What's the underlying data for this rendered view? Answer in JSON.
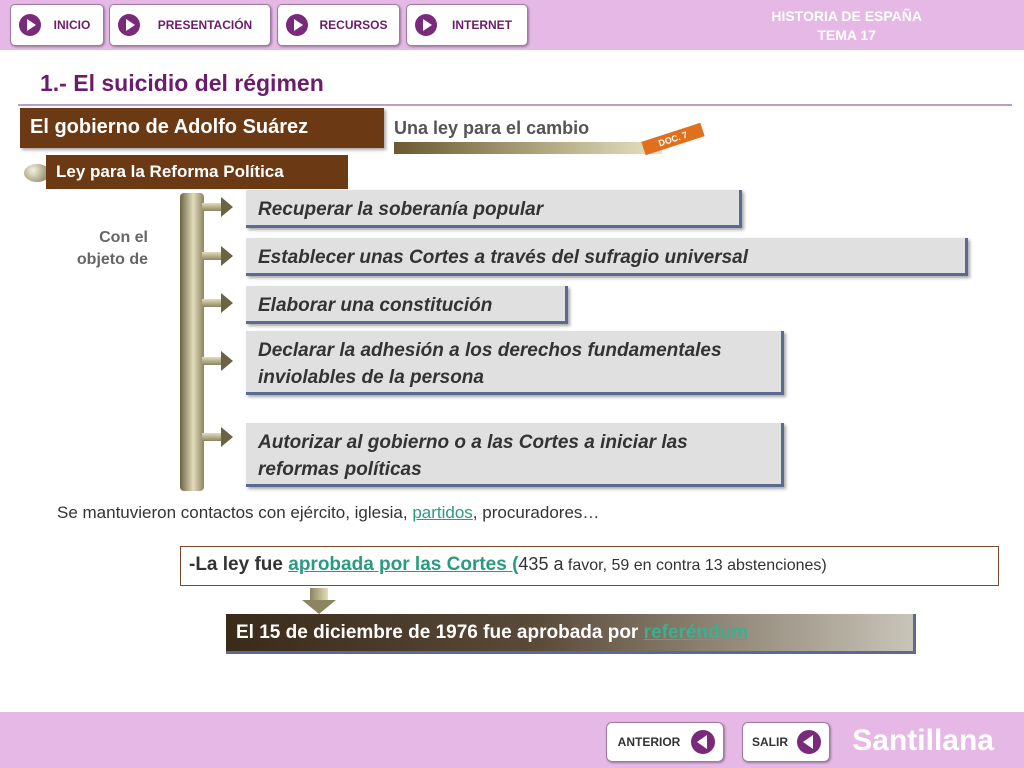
{
  "topbar": {
    "nav": [
      {
        "label": "INICIO"
      },
      {
        "label": "PRESENTACIÓN"
      },
      {
        "label": "RECURSOS"
      },
      {
        "label": "INTERNET"
      }
    ],
    "subject": "HISTORIA DE ESPAÑA",
    "unit": "TEMA 17"
  },
  "title": "1.- El suicidio del régimen",
  "section": "El gobierno de Adolfo Suárez",
  "law_heading": "Una ley para el cambio",
  "doc_badge": "DOC. 7",
  "subheading": "Ley para la Reforma Política",
  "aside_line1": "Con el",
  "aside_line2": "objeto de",
  "objectives": [
    "Recuperar la soberanía popular",
    "Establecer unas Cortes a través del sufragio universal",
    "Elaborar una constitución",
    "Declarar la adhesión a los derechos fundamentales inviolables de la persona",
    "Autorizar al gobierno o a las Cortes a iniciar las reformas políticas"
  ],
  "contacts": {
    "prefix": "Se mantuvieron contactos con ejército, iglesia, ",
    "link": "partidos",
    "suffix": ", procuradores…"
  },
  "approval": {
    "prefix": "-La ley fue ",
    "link": "aprobada por las Cortes  (",
    "count": "435 a",
    "rest": " favor, 59 en contra 13 abstenciones)"
  },
  "final": {
    "prefix": "El 15 de diciembre de 1976 fue ",
    "middle": "aprobada por ",
    "link": "referéndum"
  },
  "bottombar": {
    "prev": "ANTERIOR",
    "exit": "SALIR",
    "brand": "Santillana"
  }
}
